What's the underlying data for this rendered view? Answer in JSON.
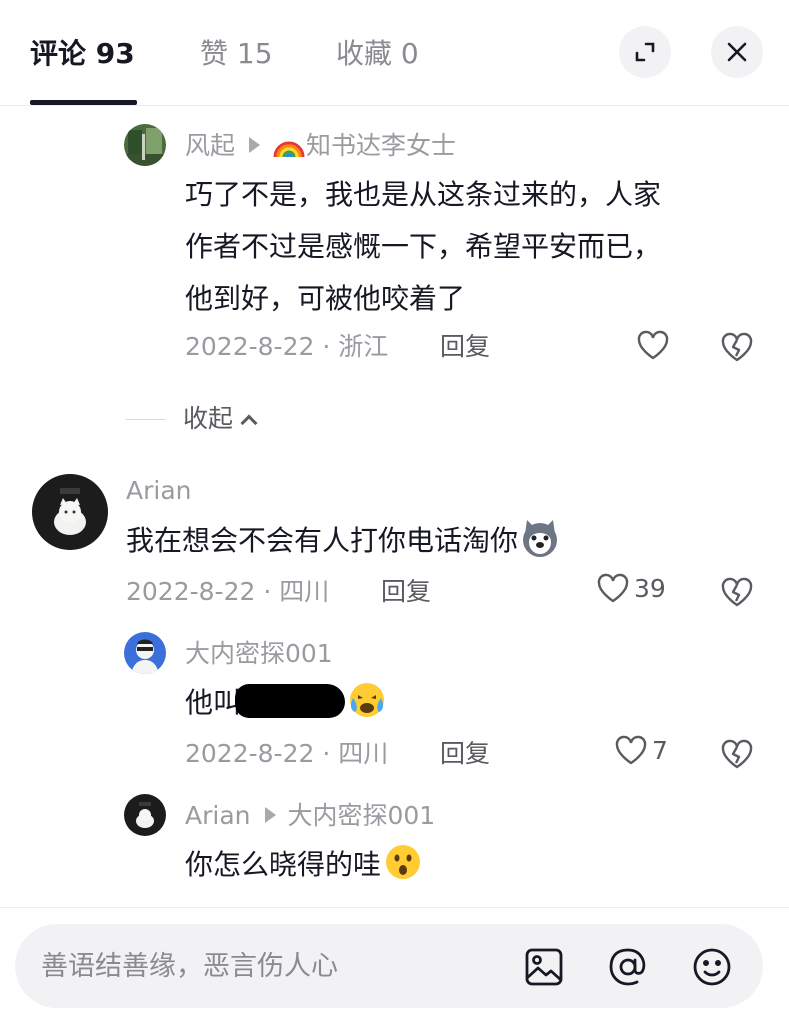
{
  "tabs": {
    "comments": "评论 93",
    "likes": "赞 15",
    "favorites": "收藏 0"
  },
  "header_icons": {
    "expand": "expand-icon",
    "close": "close-icon"
  },
  "comments": [
    {
      "author": "风起",
      "reply_to": "知书达李女士",
      "reply_to_prefix_icon": "rainbow-icon",
      "text": "巧了不是，我也是从这条过来的，人家\n作者不过是感慨一下，希望平安而已，\n他到好，可被他咬着了",
      "meta": "2022-8-22 · 浙江",
      "reply_label": "回复",
      "likes": ""
    },
    {
      "author": "Arian",
      "text": "我在想会不会有人打你电话淘你",
      "emoji": "husky-face-emoji",
      "meta": "2022-8-22 · 四川",
      "reply_label": "回复",
      "likes": "39"
    },
    {
      "author": "大内密探001",
      "text_prefix": "他叫",
      "text_redacted": true,
      "emoji": "crying-face-emoji",
      "meta": "2022-8-22 · 四川",
      "reply_label": "回复",
      "likes": "7"
    },
    {
      "author": "Arian",
      "reply_to": "大内密探001",
      "text": "你怎么晓得的哇",
      "emoji": "surprised-face-emoji"
    }
  ],
  "collapse_label": "收起",
  "input": {
    "placeholder": "善语结善缘，恶言伤人心",
    "icons": [
      "image-icon",
      "at-icon",
      "emoji-icon"
    ]
  },
  "colors": {
    "primary_text": "#161823",
    "secondary_text": "#9a9ba1",
    "input_bg": "#f2f2f4"
  }
}
